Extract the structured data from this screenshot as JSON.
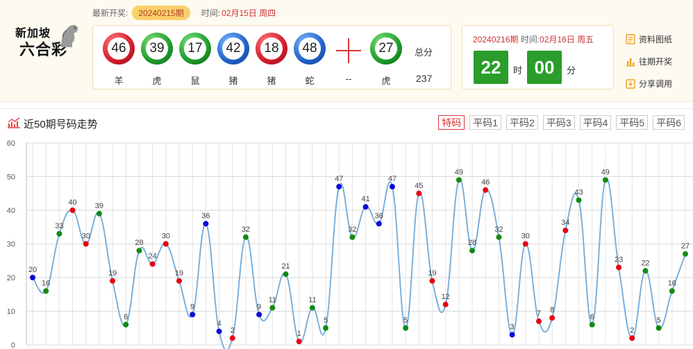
{
  "header": {
    "logo_line1": "新加坡",
    "logo_line2": "六合彩",
    "latest_label": "最新开奖:",
    "latest_issue": "20240215期",
    "time_label": "时间:",
    "time_value": "02月15日 周四"
  },
  "draw": {
    "balls": [
      {
        "number": "46",
        "zodiac": "羊",
        "color": "red"
      },
      {
        "number": "39",
        "zodiac": "虎",
        "color": "green"
      },
      {
        "number": "17",
        "zodiac": "鼠",
        "color": "green"
      },
      {
        "number": "42",
        "zodiac": "猪",
        "color": "blue"
      },
      {
        "number": "18",
        "zodiac": "猪",
        "color": "red"
      },
      {
        "number": "48",
        "zodiac": "蛇",
        "color": "blue"
      }
    ],
    "plus_zodiac": "--",
    "special": {
      "number": "27",
      "zodiac": "虎",
      "color": "green"
    },
    "sum_label": "总分",
    "sum_value": "237"
  },
  "next": {
    "issue": "20240216期",
    "time_label": "时间:",
    "time_value": "02月16日 周五",
    "hours": "22",
    "hours_unit": "时",
    "minutes": "00",
    "minutes_unit": "分"
  },
  "links": [
    {
      "label": "资料图纸",
      "icon": "document-icon"
    },
    {
      "label": "往期开奖",
      "icon": "bar-chart-icon"
    },
    {
      "label": "分享调用",
      "icon": "share-icon"
    }
  ],
  "section": {
    "title": "近50期号码走势",
    "tabs": [
      "特码",
      "平码1",
      "平码2",
      "平码3",
      "平码4",
      "平码5",
      "平码6"
    ],
    "active_tab": 0
  },
  "colors": {
    "red": "#e60012",
    "green": "#138a13",
    "blue": "#0a0ad6",
    "line": "#7ab0dc"
  },
  "chart_data": {
    "type": "line",
    "ylim": [
      0,
      60
    ],
    "yticks": [
      0,
      10,
      20,
      30,
      40,
      50,
      60
    ],
    "series": [
      {
        "values": [
          20,
          16,
          33,
          40,
          30,
          39,
          19,
          6,
          28,
          24,
          30,
          19,
          9,
          36,
          4,
          2,
          32,
          9,
          11,
          21,
          1,
          11,
          5,
          47,
          32,
          41,
          36,
          47,
          5,
          45,
          19,
          12,
          49,
          28,
          46,
          32,
          3,
          30,
          7,
          8,
          34,
          43,
          6,
          49,
          23,
          2,
          22,
          5,
          16,
          27
        ],
        "colors": [
          "blue",
          "green",
          "green",
          "red",
          "red",
          "green",
          "red",
          "green",
          "green",
          "red",
          "red",
          "red",
          "blue",
          "blue",
          "blue",
          "red",
          "green",
          "blue",
          "green",
          "green",
          "red",
          "green",
          "green",
          "blue",
          "green",
          "blue",
          "blue",
          "blue",
          "green",
          "red",
          "red",
          "red",
          "green",
          "green",
          "red",
          "green",
          "blue",
          "red",
          "red",
          "red",
          "red",
          "green",
          "green",
          "green",
          "red",
          "red",
          "green",
          "green",
          "green",
          "green"
        ]
      }
    ]
  }
}
